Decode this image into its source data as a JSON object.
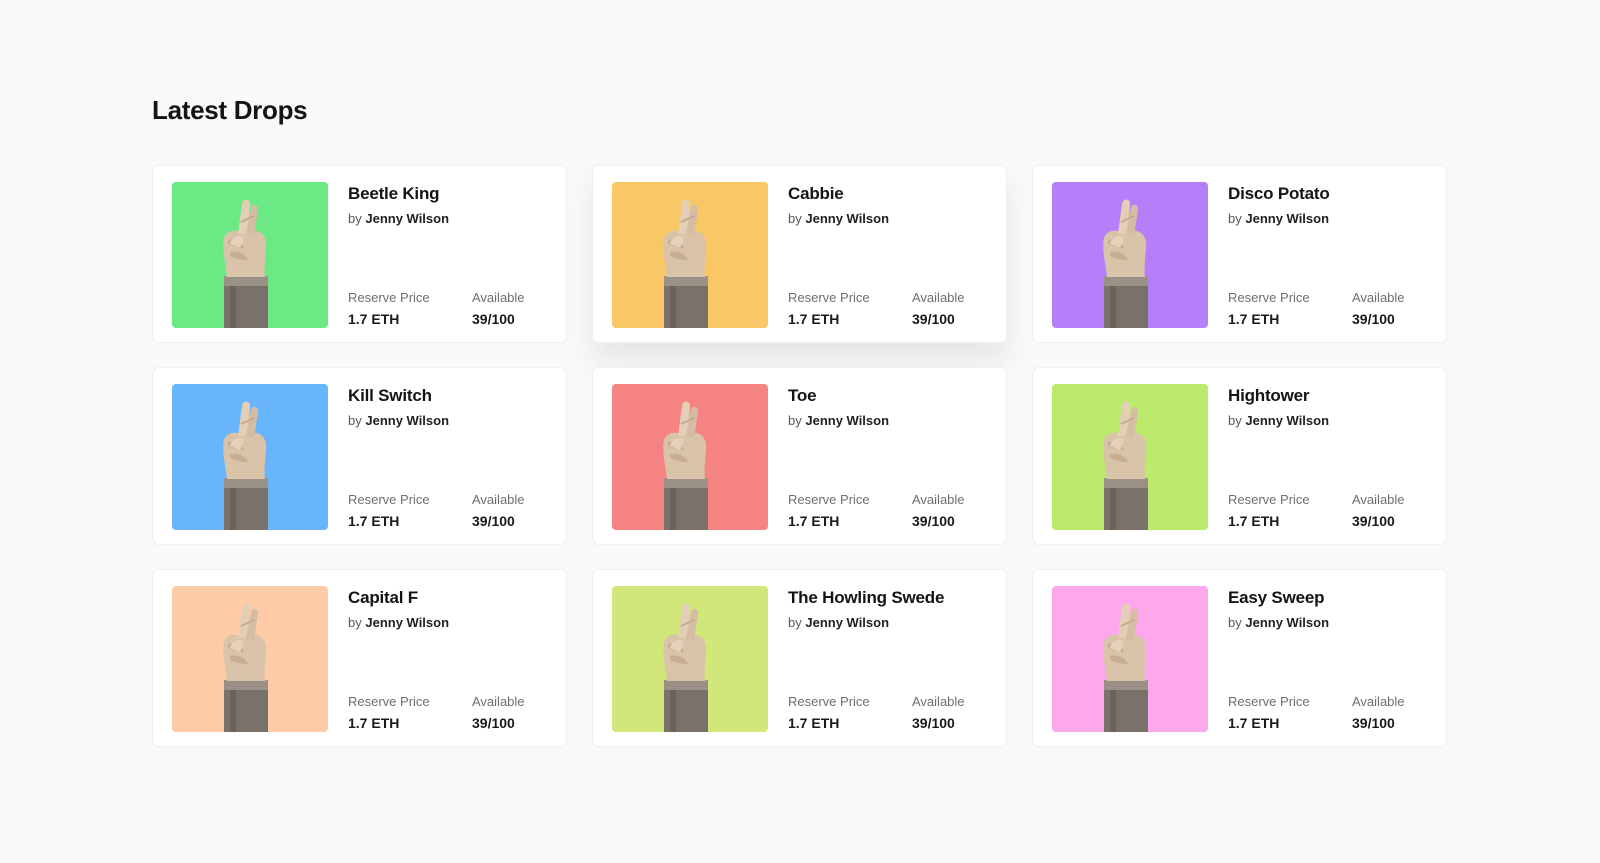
{
  "section": {
    "title": "Latest Drops"
  },
  "labels": {
    "by": "by",
    "reserve_price": "Reserve Price",
    "available": "Available"
  },
  "cards": [
    {
      "name": "Beetle King",
      "author": "Jenny Wilson",
      "price": "1.7 ETH",
      "available": "39/100",
      "bg": "#6be985"
    },
    {
      "name": "Cabbie",
      "author": "Jenny Wilson",
      "price": "1.7 ETH",
      "available": "39/100",
      "bg": "#f9c766"
    },
    {
      "name": "Disco Potato",
      "author": "Jenny Wilson",
      "price": "1.7 ETH",
      "available": "39/100",
      "bg": "#b57ff9"
    },
    {
      "name": "Kill Switch",
      "author": "Jenny Wilson",
      "price": "1.7 ETH",
      "available": "39/100",
      "bg": "#69b5fb"
    },
    {
      "name": "Toe",
      "author": "Jenny Wilson",
      "price": "1.7 ETH",
      "available": "39/100",
      "bg": "#f48382"
    },
    {
      "name": "Hightower",
      "author": "Jenny Wilson",
      "price": "1.7 ETH",
      "available": "39/100",
      "bg": "#bbea6c"
    },
    {
      "name": "Capital F",
      "author": "Jenny Wilson",
      "price": "1.7 ETH",
      "available": "39/100",
      "bg": "#fdcca6"
    },
    {
      "name": "The Howling Swede",
      "author": "Jenny Wilson",
      "price": "1.7 ETH",
      "available": "39/100",
      "bg": "#d2e77a"
    },
    {
      "name": "Easy Sweep",
      "author": "Jenny Wilson",
      "price": "1.7 ETH",
      "available": "39/100",
      "bg": "#fda8ed"
    }
  ],
  "icons": {
    "artwork": "crossed-fingers-hand-icon"
  }
}
